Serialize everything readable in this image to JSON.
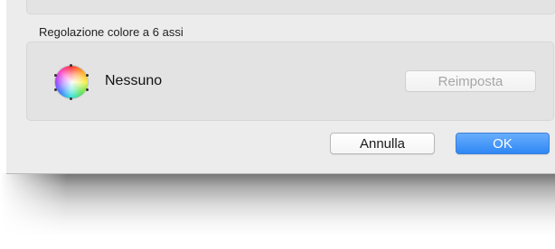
{
  "section": {
    "title": "Regolazione colore a 6 assi",
    "value": "Nessuno",
    "reset_label": "Reimposta",
    "icon": "color-wheel-icon"
  },
  "dialog": {
    "cancel_label": "Annulla",
    "ok_label": "OK"
  },
  "colors": {
    "accent": "#3a8cf7",
    "disabled_text": "#a6a6a6",
    "sheet_bg": "#ececec",
    "group_bg": "#e3e3e3"
  }
}
